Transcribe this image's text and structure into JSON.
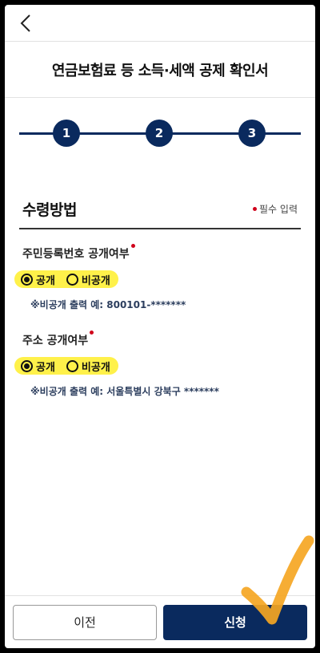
{
  "header": {
    "title": "연금보험료 등 소득·세액 공제 확인서"
  },
  "stepper": {
    "steps": [
      "1",
      "2",
      "3"
    ]
  },
  "section": {
    "title": "수령방법",
    "required_note": "필수 입력"
  },
  "fields": [
    {
      "label": "주민등록번호 공개여부",
      "options": [
        "공개",
        "비공개"
      ],
      "selected": "공개",
      "note": "※비공개 출력 예: 800101-*******"
    },
    {
      "label": "주소 공개여부",
      "options": [
        "공개",
        "비공개"
      ],
      "selected": "공개",
      "note": "※비공개 출력 예: 서울특별시 강북구 *******"
    }
  ],
  "footer": {
    "prev_label": "이전",
    "apply_label": "신청"
  },
  "colors": {
    "primary": "#0a2a5e",
    "highlight": "#fff14a",
    "required": "#d0021b",
    "annotation": "#f5a623"
  }
}
